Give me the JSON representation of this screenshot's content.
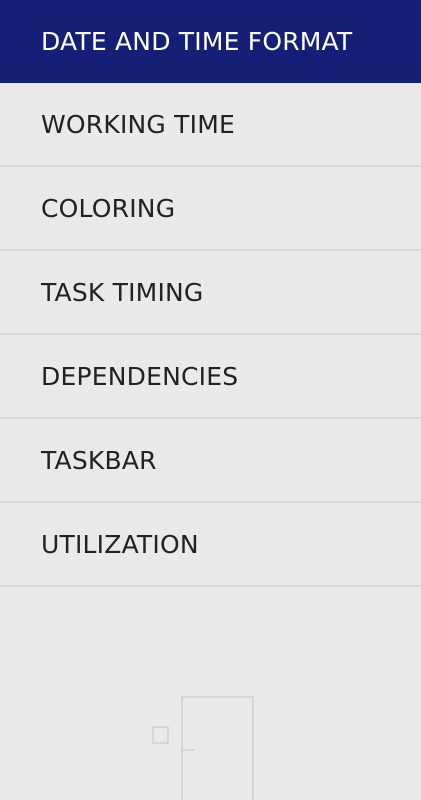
{
  "menu": {
    "items": [
      {
        "label": "DATE AND TIME FORMAT",
        "active": true
      },
      {
        "label": "WORKING TIME",
        "active": false
      },
      {
        "label": "COLORING",
        "active": false
      },
      {
        "label": "TASK TIMING",
        "active": false
      },
      {
        "label": "DEPENDENCIES",
        "active": false
      },
      {
        "label": "TASKBAR",
        "active": false
      },
      {
        "label": "UTILIZATION",
        "active": false
      }
    ]
  },
  "colors": {
    "active_background": "#141f75",
    "sidebar_background": "#e9e9e9",
    "text": "#222222",
    "divider": "#d9d9d9"
  },
  "icons": {
    "empty_state": "door-illustration-icon"
  }
}
